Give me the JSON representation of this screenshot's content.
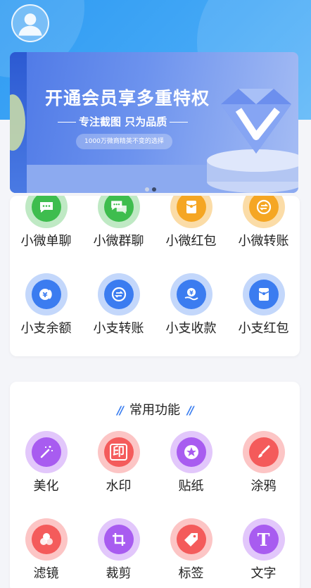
{
  "banner": {
    "title": "开通会员享多重特权",
    "subtitle": "专注截图 只为品质",
    "tagline": "1000万微商精英不变的选择"
  },
  "payment_grid": [
    {
      "label": "小微单聊",
      "icon": "chat-bubble-icon",
      "color": "#3ebd4e",
      "ring": "#bfe9c4"
    },
    {
      "label": "小微群聊",
      "icon": "group-chat-icon",
      "color": "#3ebd4e",
      "ring": "#bfe9c4"
    },
    {
      "label": "小微红包",
      "icon": "red-packet-icon",
      "color": "#f5a623",
      "ring": "#fbdca7"
    },
    {
      "label": "小微转账",
      "icon": "transfer-icon",
      "color": "#f5a623",
      "ring": "#fbdca7"
    },
    {
      "label": "小支余额",
      "icon": "balance-icon",
      "color": "#3b7cf0",
      "ring": "#c3d7fb"
    },
    {
      "label": "小支转账",
      "icon": "transfer-icon",
      "color": "#3b7cf0",
      "ring": "#c3d7fb"
    },
    {
      "label": "小支收款",
      "icon": "receive-money-icon",
      "color": "#3b7cf0",
      "ring": "#c3d7fb"
    },
    {
      "label": "小支红包",
      "icon": "red-packet-icon",
      "color": "#3b7cf0",
      "ring": "#c3d7fb"
    }
  ],
  "common_section": {
    "title": "常用功能",
    "items": [
      {
        "label": "美化",
        "icon": "magic-wand-icon",
        "color": "#a85cf0",
        "ring": "#e2c7fb"
      },
      {
        "label": "水印",
        "icon": "stamp-icon",
        "color": "#f45b5b",
        "ring": "#fcc5c5"
      },
      {
        "label": "贴纸",
        "icon": "star-sticker-icon",
        "color": "#a85cf0",
        "ring": "#e2c7fb"
      },
      {
        "label": "涂鸦",
        "icon": "brush-icon",
        "color": "#f45b5b",
        "ring": "#fcc5c5"
      },
      {
        "label": "滤镜",
        "icon": "filter-icon",
        "color": "#f45b5b",
        "ring": "#fcc5c5"
      },
      {
        "label": "裁剪",
        "icon": "crop-icon",
        "color": "#a85cf0",
        "ring": "#e2c7fb"
      },
      {
        "label": "标签",
        "icon": "tag-icon",
        "color": "#f45b5b",
        "ring": "#fcc5c5"
      },
      {
        "label": "文字",
        "icon": "text-icon",
        "color": "#a85cf0",
        "ring": "#e2c7fb"
      }
    ],
    "stamp_glyph": "印",
    "text_glyph": "T"
  },
  "carousel": {
    "total": 2,
    "active": 2
  }
}
